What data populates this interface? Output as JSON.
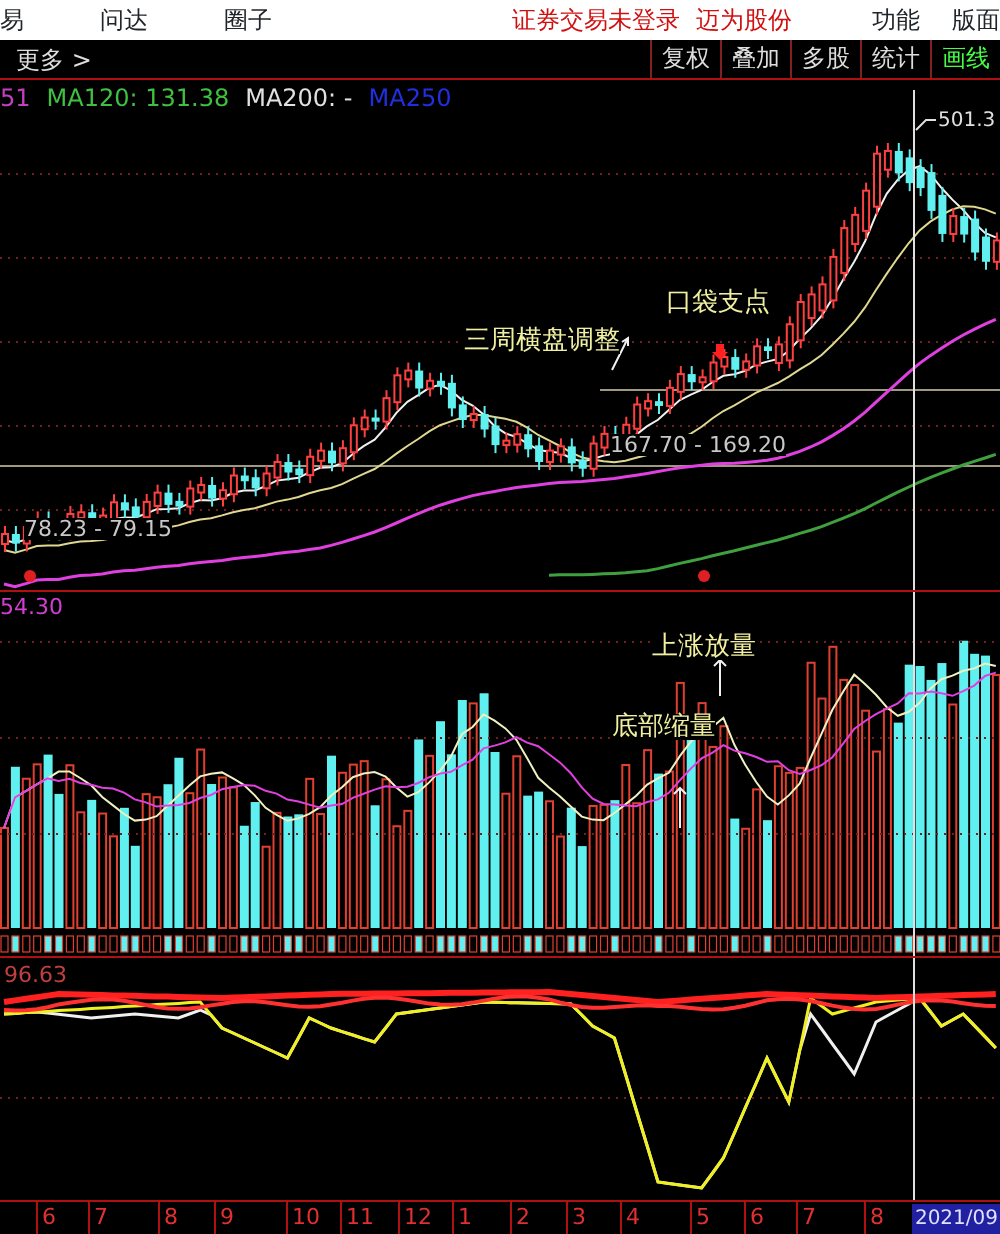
{
  "menu": [
    {
      "label": "易"
    },
    {
      "label": "问达"
    },
    {
      "label": "圈子"
    }
  ],
  "status": {
    "login": "证券交易未登录",
    "stock": "迈为股份"
  },
  "menu_right": [
    "功能",
    "版面"
  ],
  "more": "更多 >",
  "tools": [
    "复权",
    "叠加",
    "多股",
    "统计",
    "画线"
  ],
  "ma_legend": [
    {
      "text": "51",
      "color": "#c040c0"
    },
    {
      "text": "MA120: 131.38",
      "color": "#40c040"
    },
    {
      "text": "MA200: -",
      "color": "#e0e0e0"
    },
    {
      "text": "MA250",
      "color": "#2030e0"
    }
  ],
  "price_chart": {
    "high_label": "501.3",
    "annotations": [
      "三周横盘调整",
      "口袋支点"
    ],
    "range_labels": [
      "167.70 - 169.20",
      "78.23 - 79.15"
    ]
  },
  "volume_chart": {
    "scale": "54.30",
    "annotations": [
      "上涨放量",
      "底部缩量"
    ]
  },
  "indicator_chart": {
    "scale": "96.63"
  },
  "time_axis": {
    "months": [
      "6",
      "7",
      "8",
      "9",
      "10",
      "11",
      "12",
      "1",
      "2",
      "3",
      "4",
      "5",
      "6",
      "7",
      "8"
    ],
    "cursor_date": "2021/09"
  }
}
